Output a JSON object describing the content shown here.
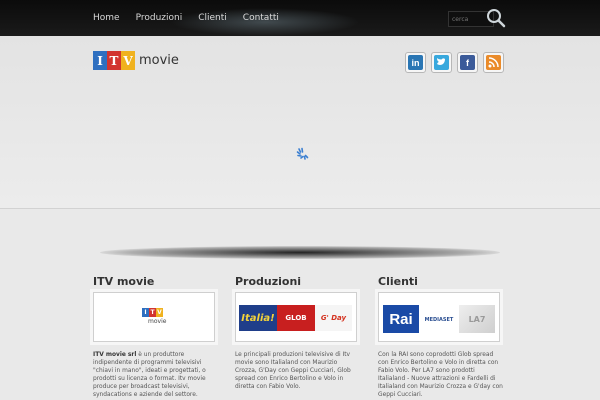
{
  "nav": {
    "items": [
      "Home",
      "Produzioni",
      "Clienti",
      "Contatti"
    ],
    "search_placeholder": "cerca"
  },
  "logo": {
    "letters": [
      "I",
      "T",
      "V"
    ],
    "word": "movie"
  },
  "social": [
    "linkedin-icon",
    "twitter-icon",
    "facebook-icon",
    "rss-icon"
  ],
  "columns": [
    {
      "title": "ITV movie",
      "logo_letters": [
        "I",
        "T",
        "V"
      ],
      "logo_word": "movie",
      "text_lead": "ITV movie srl",
      "text_rest": " è un produttore indipendente di programmi televisivi \"chiavi in mano\", ideati e progettati, o prodotti su licenza o format. Itv movie produce per broadcast televisivi, syndacations e aziende del settore."
    },
    {
      "title": "Produzioni",
      "banner": [
        "Italia!",
        "GLOB",
        "G' Day"
      ],
      "text": "Le principali produzioni televisive di Itv movie sono Italialand con Maurizio Crozza, G'Day con Geppi Cucciari, Glob spread con Enrico Bertolino e Volo in diretta con Fabio Volo."
    },
    {
      "title": "Clienti",
      "banner": [
        "Rai",
        "MEDIASET",
        "LA7"
      ],
      "text": "Con la RAI sono coprodotti Glob spread con Enrico Bertolino e Volo in diretta con Fabio Volo. Per LA7 sono prodotti Italialand - Nuove attrazioni e Fardelli di Italialand con Maurizio Crozza e G'day con Geppi Cucciari."
    }
  ],
  "colors": {
    "topbar": "#111111",
    "logo_blue": "#2e6fc0",
    "logo_red": "#d2342f",
    "logo_yellow": "#f0b21f",
    "page_bg": "#e9e9e9"
  }
}
